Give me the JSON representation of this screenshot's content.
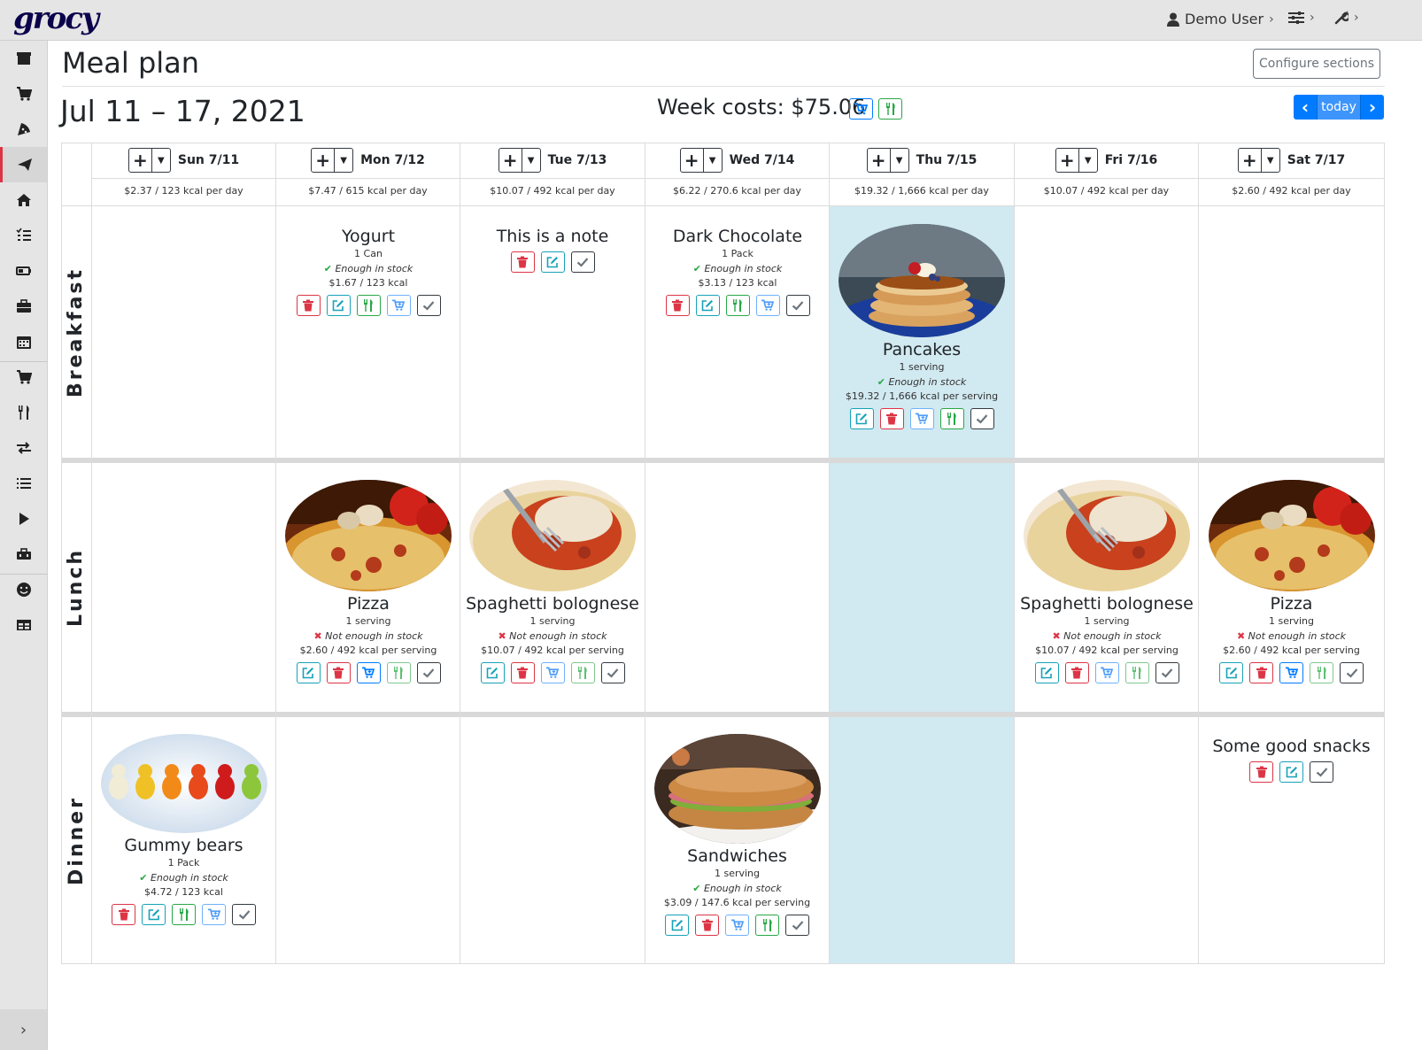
{
  "app": {
    "logo": "grocy"
  },
  "topbar": {
    "user": "Demo User"
  },
  "page": {
    "title": "Meal plan",
    "configure_label": "Configure sections",
    "date_range": "Jul 11 – 17, 2021",
    "week_costs": "Week costs: $75.06",
    "today_label": "today"
  },
  "colors": {
    "accent": "#007bff",
    "danger": "#dc3545",
    "success": "#28a745",
    "info": "#17a2b8",
    "today_bg": "#d1e9f0"
  },
  "days": [
    {
      "label": "Sun 7/11",
      "summary": "$2.37 / 123 kcal per day"
    },
    {
      "label": "Mon 7/12",
      "summary": "$7.47 / 615 kcal per day"
    },
    {
      "label": "Tue 7/13",
      "summary": "$10.07 / 492 kcal per day"
    },
    {
      "label": "Wed 7/14",
      "summary": "$6.22 / 270.6 kcal per day"
    },
    {
      "label": "Thu 7/15",
      "summary": "$19.32 / 1,666 kcal per day"
    },
    {
      "label": "Fri 7/16",
      "summary": "$10.07 / 492 kcal per day"
    },
    {
      "label": "Sat 7/17",
      "summary": "$2.60 / 492 kcal per day"
    }
  ],
  "sections": [
    {
      "label": "Breakfast"
    },
    {
      "label": "Lunch"
    },
    {
      "label": "Dinner"
    }
  ],
  "entries": {
    "yogurt": {
      "name": "Yogurt",
      "amount": "1 Can",
      "stock": "Enough in stock",
      "cost": "$1.67 / 123 kcal"
    },
    "note": {
      "name": "This is a note"
    },
    "chocolate": {
      "name": "Dark Chocolate",
      "amount": "1 Pack",
      "stock": "Enough in stock",
      "cost": "$3.13 / 123 kcal"
    },
    "pancakes": {
      "name": "Pancakes",
      "amount": "1 serving",
      "stock": "Enough in stock",
      "cost": "$19.32 / 1,666 kcal per serving"
    },
    "pizza_mon": {
      "name": "Pizza",
      "amount": "1 serving",
      "stock": "Not enough in stock",
      "cost": "$2.60 / 492 kcal per serving"
    },
    "spag_tue": {
      "name": "Spaghetti bolognese",
      "amount": "1 serving",
      "stock": "Not enough in stock",
      "cost": "$10.07 / 492 kcal per serving"
    },
    "spag_fri": {
      "name": "Spaghetti bolognese",
      "amount": "1 serving",
      "stock": "Not enough in stock",
      "cost": "$10.07 / 492 kcal per serving"
    },
    "pizza_sat": {
      "name": "Pizza",
      "amount": "1 serving",
      "stock": "Not enough in stock",
      "cost": "$2.60 / 492 kcal per serving"
    },
    "gummy": {
      "name": "Gummy bears",
      "amount": "1 Pack",
      "stock": "Enough in stock",
      "cost": "$4.72 / 123 kcal"
    },
    "sandwiches": {
      "name": "Sandwiches",
      "amount": "1 serving",
      "stock": "Enough in stock",
      "cost": "$3.09 / 147.6 kcal per serving"
    },
    "snacks": {
      "name": "Some good snacks"
    }
  },
  "sidebar_icons": [
    "box-icon",
    "cart-icon",
    "pizza-icon",
    "paper-plane-icon",
    "home-icon",
    "tasks-icon",
    "battery-icon",
    "briefcase-icon",
    "calendar-icon",
    "shopping-cart-icon",
    "utensils-icon",
    "exchange-icon",
    "list-icon",
    "play-icon",
    "toolbox-icon",
    "smile-icon",
    "table-icon"
  ]
}
